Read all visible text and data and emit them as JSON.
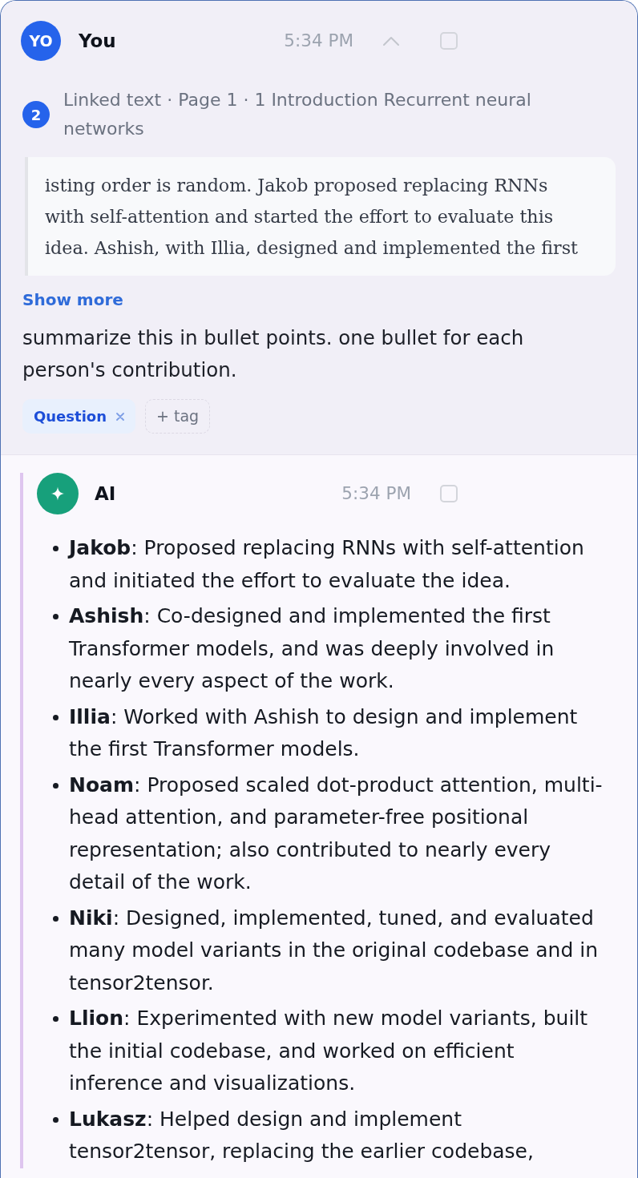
{
  "user_message": {
    "avatar": "YO",
    "author": "You",
    "time": "5:34 PM",
    "expanded": true,
    "checked": false,
    "linked_text": {
      "count": "2",
      "label": "Linked text · Page 1 · 1 Introduction Recurrent neural networks",
      "excerpt": "isting order is random. Jakob proposed replacing RNNs with self-attention and started the effort to evaluate this idea. Ashish, with Illia, designed and implemented the first",
      "show_more": "Show more"
    },
    "text": "summarize this in bullet points. one bullet for each person's contribution.",
    "tags": [
      {
        "label": "Question"
      }
    ],
    "add_tag": "+ tag"
  },
  "ai_message": {
    "author": "AI",
    "time": "5:34 PM",
    "checked": false,
    "bullets": [
      "**Jakob**: Proposed replacing RNNs with self-attention and initiated the effort to evaluate the idea.",
      "**Ashish**: Co-designed and implemented the first Transformer models, and was deeply involved in nearly every aspect of the work.",
      "**Illia**: Worked with Ashish to design and implement the first Transformer models.",
      "**Noam**: Proposed scaled dot-product attention, multi-head attention, and parameter-free positional representation; also contributed to nearly every detail of the work.",
      "**Niki**: Designed, implemented, tuned, and evaluated many model variants in the original codebase and in tensor2tensor.",
      "**Llion**: Experimented with new model variants, built the initial codebase, and worked on efficient inference and visualizations.",
      "**Lukasz**: Helped design and implement tensor2tensor, replacing the earlier codebase,"
    ]
  }
}
